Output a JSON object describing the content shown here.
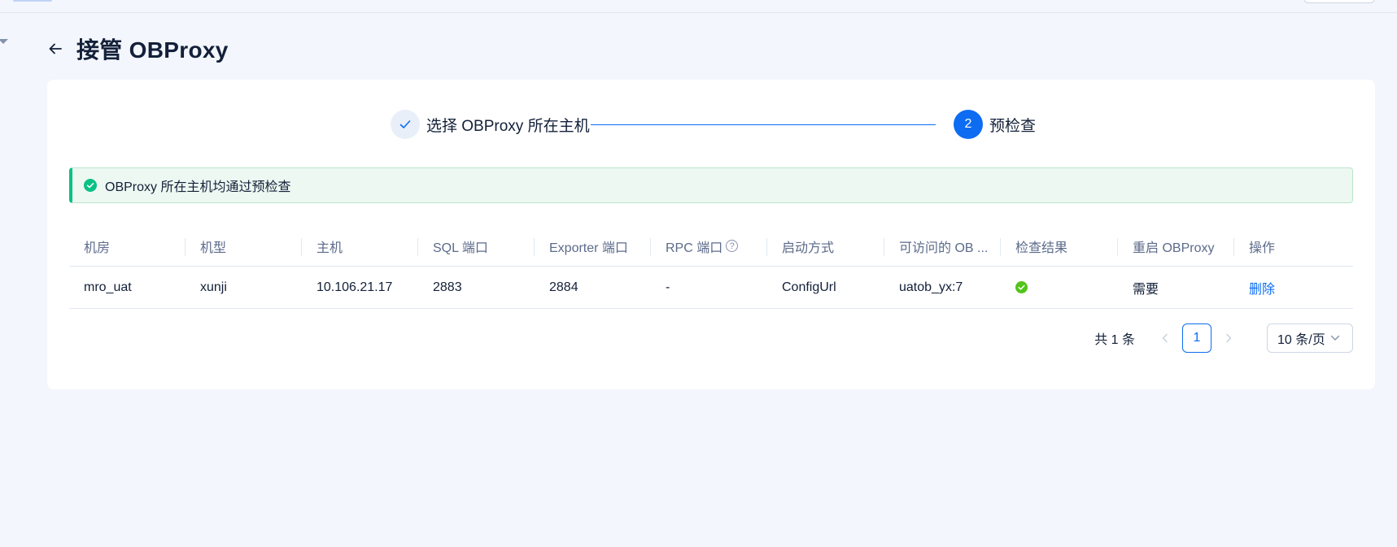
{
  "header": {
    "title": "接管 OBProxy"
  },
  "steps": [
    {
      "label": "选择 OBProxy 所在主机",
      "status": "done"
    },
    {
      "number": "2",
      "label": "预检查",
      "status": "active"
    }
  ],
  "alert": {
    "type": "success",
    "text": "OBProxy 所在主机均通过预检查"
  },
  "table": {
    "columns": [
      "机房",
      "机型",
      "主机",
      "SQL 端口",
      "Exporter 端口",
      "RPC 端口",
      "启动方式",
      "可访问的 OB ...",
      "检查结果",
      "重启 OBProxy",
      "操作"
    ],
    "rows": [
      {
        "idc": "mro_uat",
        "type": "xunji",
        "host": "10.106.21.17",
        "sql_port": "2883",
        "exporter_port": "2884",
        "rpc_port": "-",
        "start_mode": "ConfigUrl",
        "ob_cluster": "uatob_yx:7",
        "check_result": "pass",
        "restart": "需要",
        "action": "删除"
      }
    ]
  },
  "pagination": {
    "total": "共 1 条",
    "current": "1",
    "page_size": "10 条/页"
  },
  "colors": {
    "primary": "#0d6cf2",
    "success": "#0ac185",
    "success_alt": "#52c41a",
    "background": "#f3f6fc"
  },
  "icons": {
    "back": "arrow-left-icon",
    "step_done": "check-icon",
    "alert": "check-circle-icon",
    "rpc_help": "question-circle-icon",
    "result": "check-circle-icon",
    "prev": "chevron-left-icon",
    "next": "chevron-right-icon",
    "size": "chevron-down-icon"
  }
}
